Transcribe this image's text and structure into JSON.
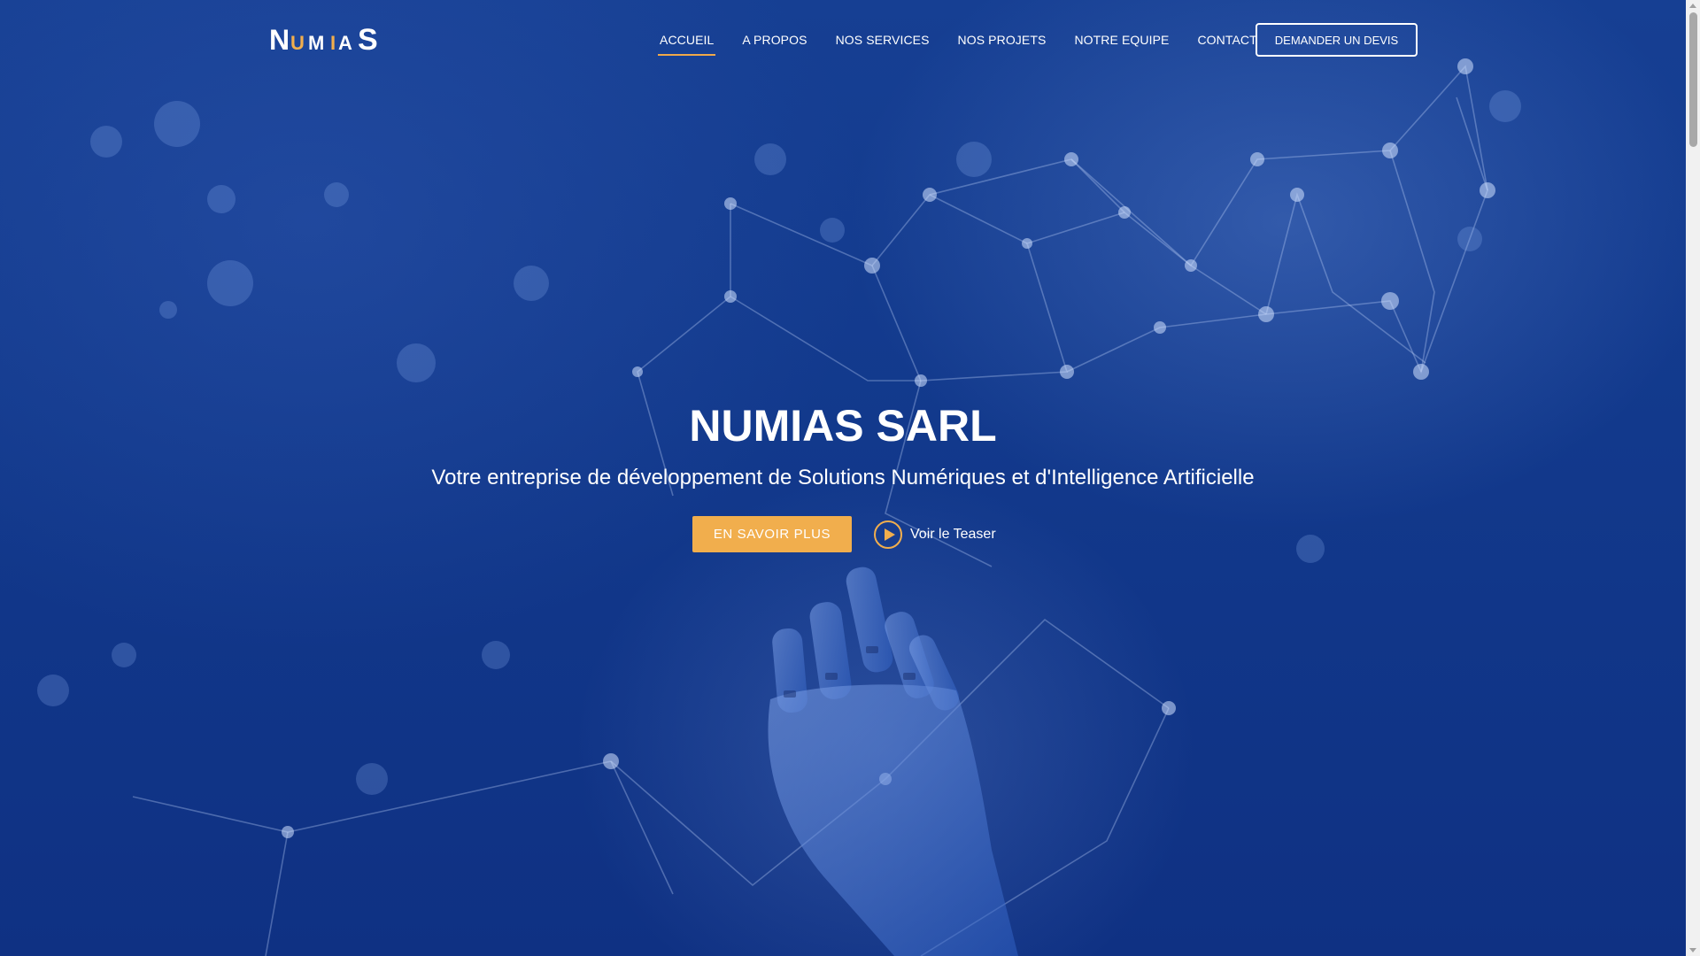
{
  "header": {
    "logo_text": "NUMIAS",
    "logo_colors": {
      "white": "#ffffff",
      "accent": "#f1ae4d"
    },
    "nav": [
      {
        "label": "ACCUEIL",
        "active": true
      },
      {
        "label": "A PROPOS",
        "active": false
      },
      {
        "label": "NOS SERVICES",
        "active": false
      },
      {
        "label": "NOS PROJETS",
        "active": false
      },
      {
        "label": "NOTRE EQUIPE",
        "active": false
      },
      {
        "label": "CONTACT",
        "active": false
      }
    ],
    "quote_button": "DEMANDER UN DEVIS"
  },
  "hero": {
    "title": "NUMIAS SARL",
    "subtitle": "Votre entreprise de développement de Solutions Numériques et d'Intelligence Artificielle",
    "cta_label": "EN SAVOIR PLUS",
    "teaser_label": "Voir le Teaser",
    "play_icon": "play-circle-icon"
  },
  "colors": {
    "background": "#12398c",
    "accent": "#f1ae4d",
    "nav_underline": "#f1a94a",
    "text": "#ffffff"
  }
}
